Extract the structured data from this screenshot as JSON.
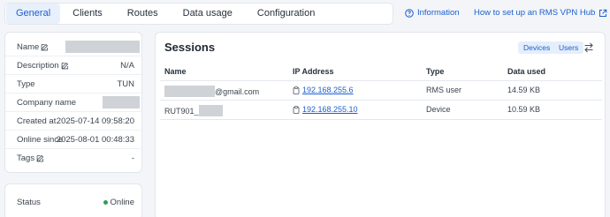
{
  "tabs": [
    {
      "label": "General",
      "active": true
    },
    {
      "label": "Clients",
      "active": false
    },
    {
      "label": "Routes",
      "active": false
    },
    {
      "label": "Data usage",
      "active": false
    },
    {
      "label": "Configuration",
      "active": false
    }
  ],
  "links": {
    "information": "Information",
    "howto": "How to set up an RMS VPN Hub"
  },
  "details": {
    "name_label": "Name",
    "description_label": "Description",
    "description_value": "N/A",
    "type_label": "Type",
    "type_value": "TUN",
    "company_label": "Company name",
    "created_label": "Created at",
    "created_value": "2025-07-14 09:58:20",
    "online_since_label": "Online since",
    "online_since_value": "2025-08-01 00:48:33",
    "tags_label": "Tags",
    "tags_value": "-"
  },
  "status": {
    "label": "Status",
    "value": "Online",
    "color": "#2e9d57"
  },
  "sessions": {
    "title": "Sessions",
    "filters": [
      "Devices",
      "Users"
    ],
    "columns": [
      "Name",
      "IP Address",
      "Type",
      "Data used"
    ],
    "rows": [
      {
        "name_suffix": "@gmail.com",
        "ip": "192.168.255.6",
        "type": "RMS user",
        "data_used": "14.59 KB"
      },
      {
        "name_prefix": "RUT901_",
        "ip": "192.168.255.10",
        "type": "Device",
        "data_used": "10.59 KB"
      }
    ]
  },
  "colors": {
    "accent": "#1c5fd0",
    "active_tab_bg": "#e8f0fb",
    "page_bg": "#f3f5f8"
  }
}
